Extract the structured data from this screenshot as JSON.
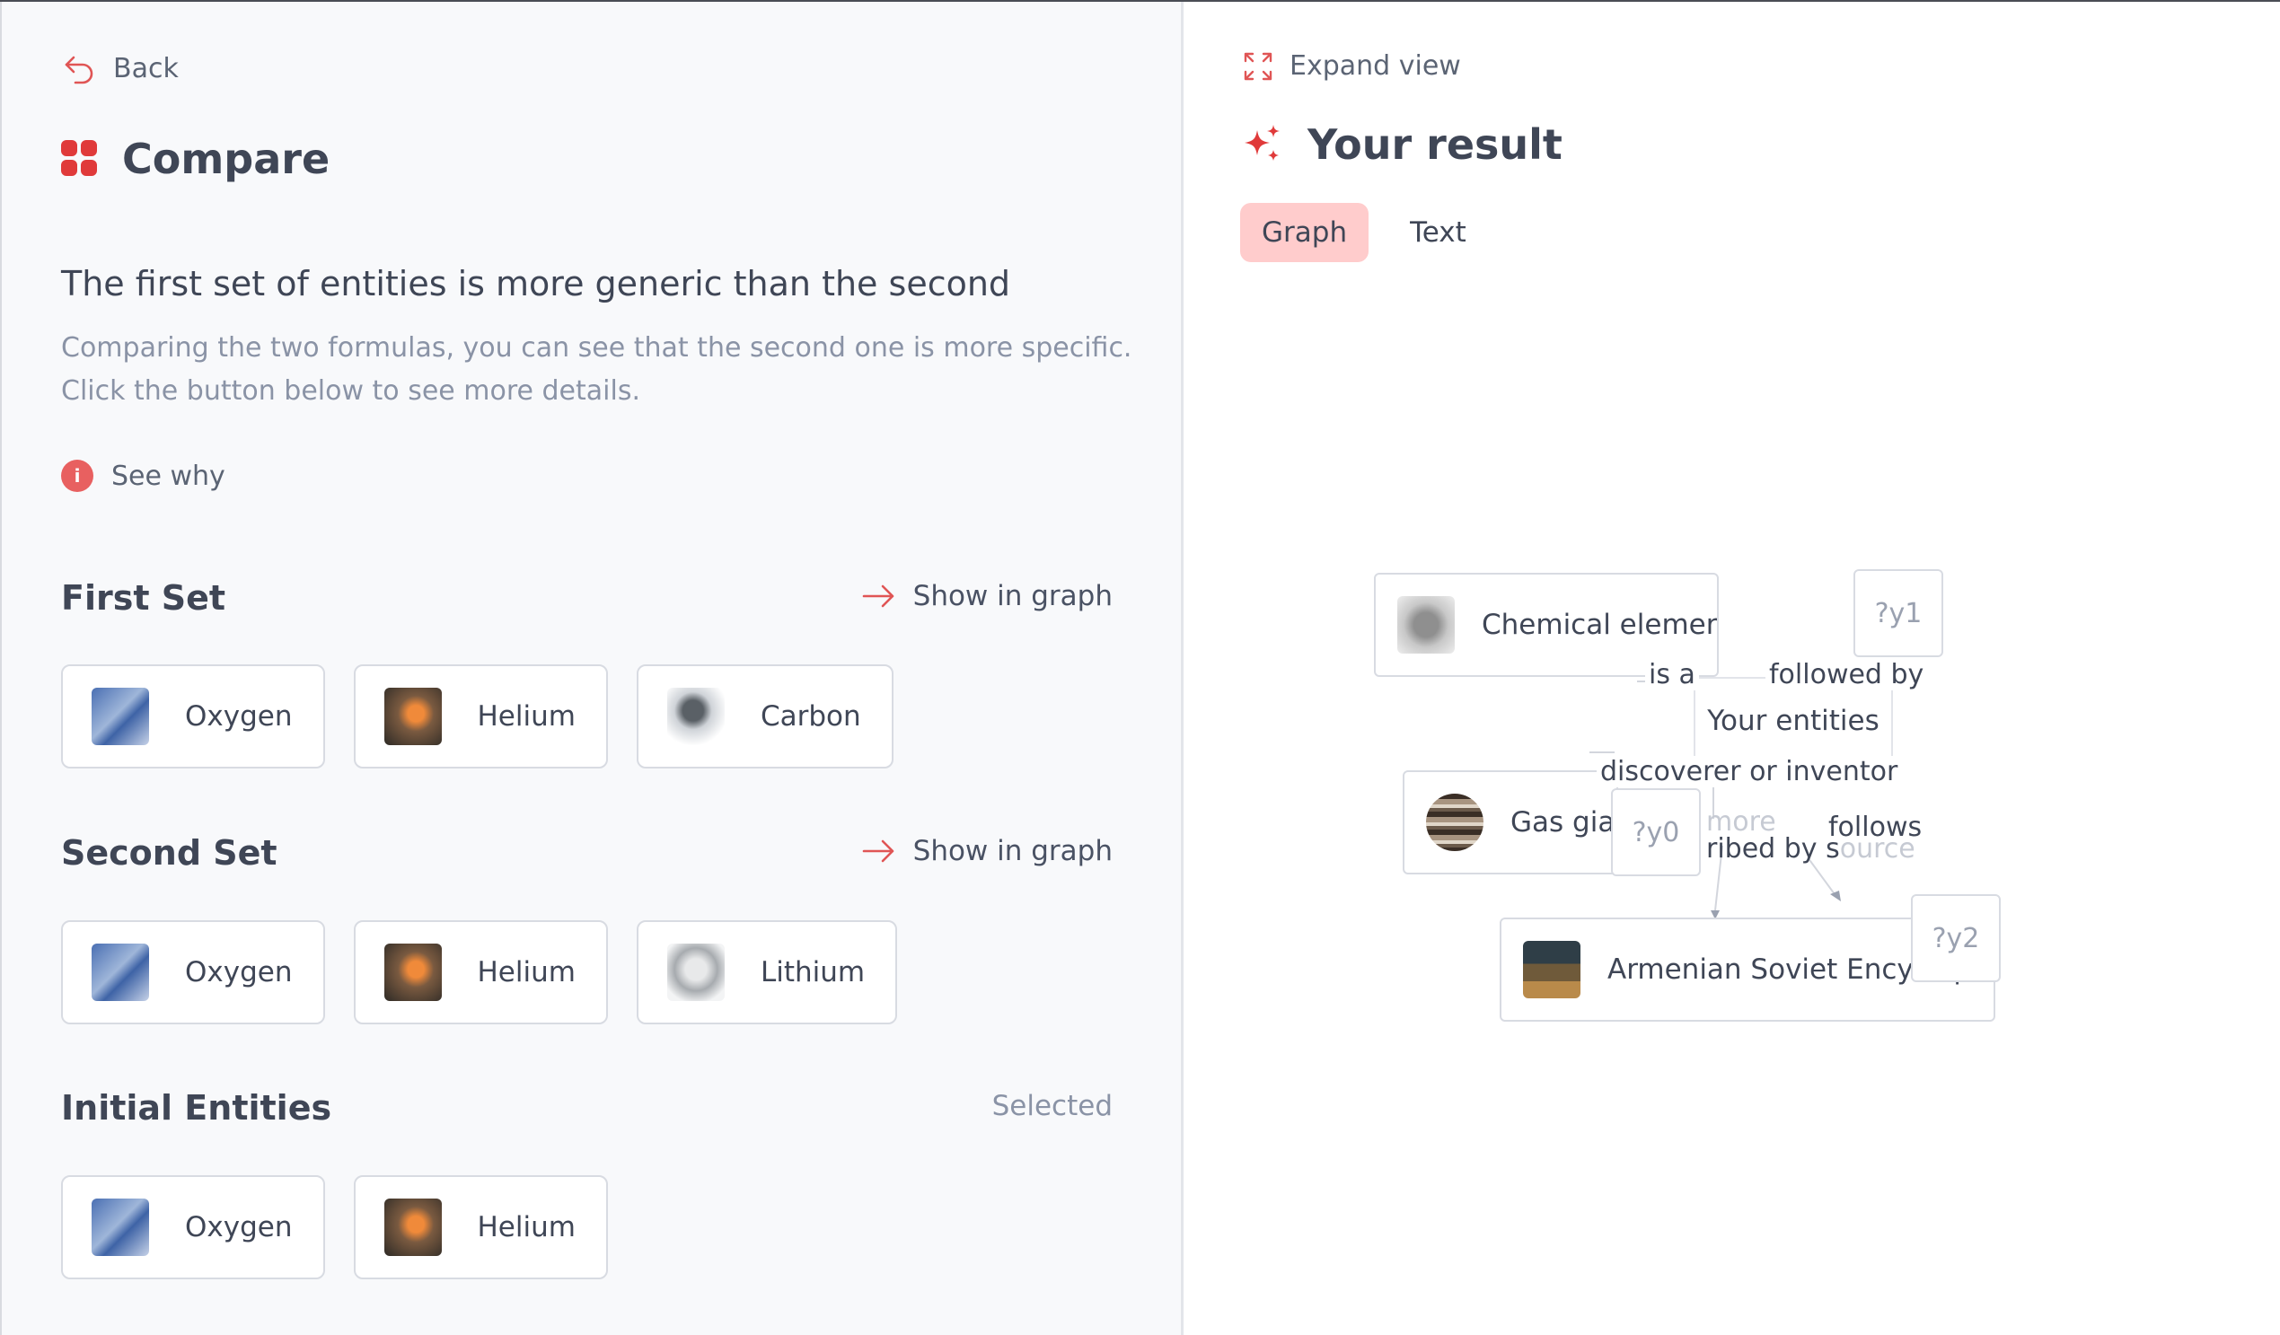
{
  "left": {
    "back_label": "Back",
    "title": "Compare",
    "headline": "The first set of entities is more generic than the second",
    "description": "Comparing the two formulas, you can see that the second one is more specific. Click the button below to see more details.",
    "see_why_label": "See why",
    "info_glyph": "i",
    "first_set": {
      "title": "First Set",
      "action_label": "Show in graph",
      "items": [
        {
          "label": "Oxygen",
          "image": "oxygen"
        },
        {
          "label": "Helium",
          "image": "helium"
        },
        {
          "label": "Carbon",
          "image": "carbon"
        }
      ]
    },
    "second_set": {
      "title": "Second Set",
      "action_label": "Show in graph",
      "items": [
        {
          "label": "Oxygen",
          "image": "oxygen"
        },
        {
          "label": "Helium",
          "image": "helium"
        },
        {
          "label": "Lithium",
          "image": "lithium"
        }
      ]
    },
    "initial_entities": {
      "title": "Initial Entities",
      "status_label": "Selected",
      "items": [
        {
          "label": "Oxygen",
          "image": "oxygen"
        },
        {
          "label": "Helium",
          "image": "helium"
        }
      ]
    }
  },
  "right": {
    "expand_label": "Expand view",
    "title": "Your result",
    "tabs": [
      {
        "label": "Graph",
        "active": true
      },
      {
        "label": "Text",
        "active": false
      }
    ],
    "graph": {
      "nodes": {
        "chemical_element": "Chemical element",
        "your_entities": "Your entities",
        "gas_giant": "Gas gian",
        "armenian": "Armenian Soviet Encyclop",
        "y0": "?y0",
        "y1": "?y1",
        "y2": "?y2"
      },
      "edges": {
        "is_a": "is a",
        "followed_by": "followed by",
        "discoverer": "discoverer or inventor",
        "described_by": "ribed by s",
        "source_faint": "ource",
        "more_faint": "more",
        "follows": "follows"
      }
    }
  },
  "colors": {
    "accent": "#e03a3a",
    "tab_active_bg": "#ffcccc",
    "muted_text": "#8a93a6"
  }
}
